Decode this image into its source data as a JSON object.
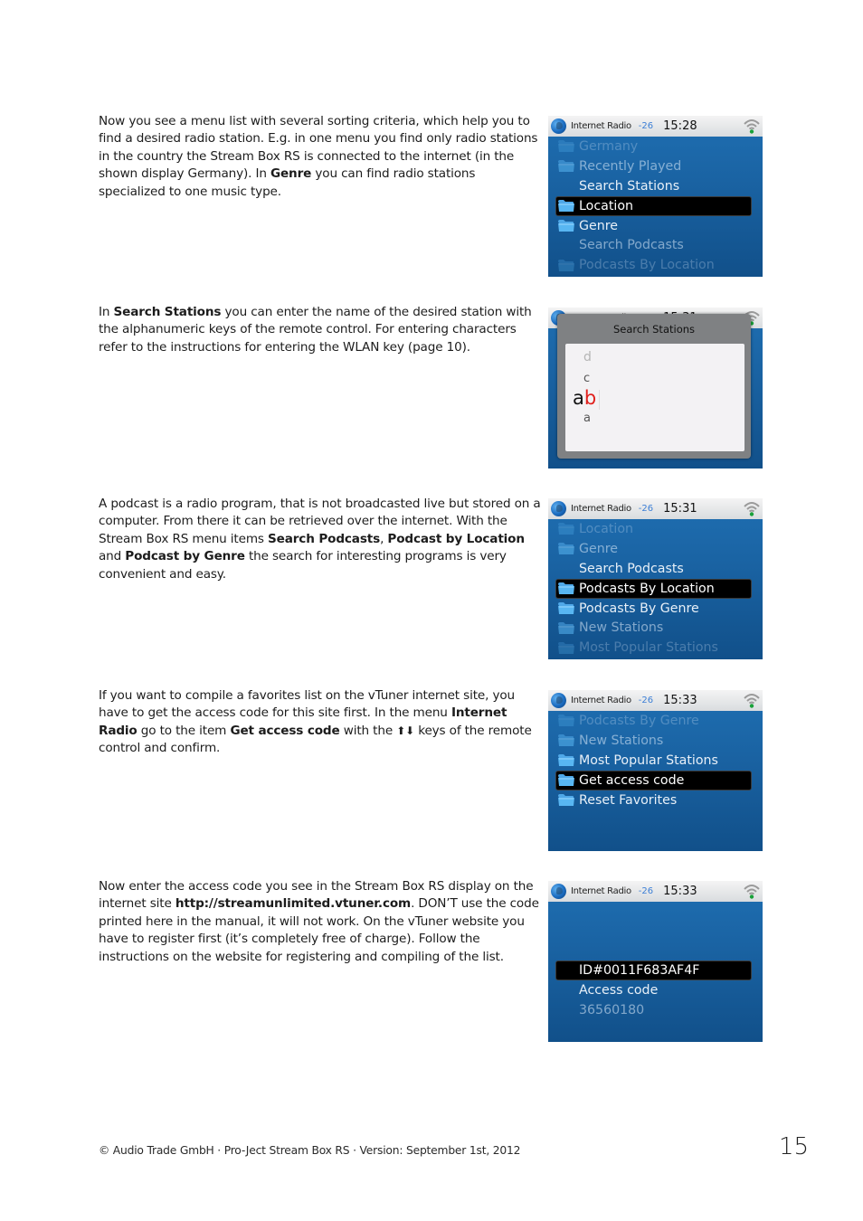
{
  "paragraphs": [
    {
      "parts": [
        {
          "t": "Now you see a menu list with several sorting criteria, which help you to find a desired radio station. E.g. in one menu you find only radio stations in the country the Stream Box RS is connected to the internet (in the shown display Germany). In "
        },
        {
          "b": "Genre"
        },
        {
          "t": " you can find radio stations specialized to one music type."
        }
      ]
    },
    {
      "parts": [
        {
          "t": "In  "
        },
        {
          "b": "Search Stations"
        },
        {
          "t": " you can enter the name of the desired station with the alphanumeric keys of the remote control. For entering characters refer to the instructions for entering the WLAN key (page 10)."
        }
      ]
    },
    {
      "parts": [
        {
          "t": "A podcast is a radio program, that is not broadcasted live but stored on a computer. From there it can be retrieved over the internet. With the Stream Box RS menu items "
        },
        {
          "b": "Search Podcasts"
        },
        {
          "t": ", "
        },
        {
          "b": "Podcast by Location"
        },
        {
          "t": " and "
        },
        {
          "b": "Podcast by Genre"
        },
        {
          "t": " the search for interesting programs is very convenient and easy."
        }
      ]
    },
    {
      "parts": [
        {
          "t": "If you want to compile a favorites list on the vTuner internet site, you have to get the access code for this site first. In the menu "
        },
        {
          "b": "Internet Radio"
        },
        {
          "t": " go to the item "
        },
        {
          "b": "Get access code"
        },
        {
          "t": " with the "
        },
        {
          "icon": "up-down-arrows",
          "glyph": "⬆⬇"
        },
        {
          "t": " keys of the remote control and confirm."
        }
      ]
    },
    {
      "parts": [
        {
          "t": "Now enter the access code you see in the Stream Box RS display on the internet site "
        },
        {
          "b": "http://streamunlimited.vtuner.com"
        },
        {
          "t": ". DON’T use the code printed here in the manual, it will not work. On the vTuner website you have to register first (it’s completely free of charge). Follow the instructions on the website for registering and compiling of the list."
        }
      ]
    }
  ],
  "screens": [
    {
      "status": {
        "title": "Internet Radio",
        "signal": "-26",
        "time": "15:28"
      },
      "items": [
        {
          "label": "Germany",
          "folder": true,
          "fade": 2
        },
        {
          "label": "Recently Played",
          "folder": true,
          "fade": 1
        },
        {
          "label": "Search Stations",
          "folder": false,
          "fade": 0
        },
        {
          "label": "Location",
          "folder": true,
          "fade": 0,
          "selected": true
        },
        {
          "label": "Genre",
          "folder": true,
          "fade": 0
        },
        {
          "label": "Search Podcasts",
          "folder": false,
          "fade": 1
        },
        {
          "label": "Podcasts By Location",
          "folder": true,
          "fade": 2
        }
      ]
    },
    {
      "status": {
        "title": "Internet Radio",
        "signal": "-26",
        "time": "15:31"
      },
      "popup": {
        "title": "Search Stations",
        "chars_above": [
          "d",
          "c"
        ],
        "input_committed": "a",
        "input_active": "b",
        "chars_below": [
          "a"
        ]
      }
    },
    {
      "status": {
        "title": "Internet Radio",
        "signal": "-26",
        "time": "15:31"
      },
      "items": [
        {
          "label": "Location",
          "folder": true,
          "fade": 2
        },
        {
          "label": "Genre",
          "folder": true,
          "fade": 1
        },
        {
          "label": "Search Podcasts",
          "folder": false,
          "fade": 0
        },
        {
          "label": "Podcasts By Location",
          "folder": true,
          "fade": 0,
          "selected": true
        },
        {
          "label": "Podcasts By Genre",
          "folder": true,
          "fade": 0
        },
        {
          "label": "New Stations",
          "folder": true,
          "fade": 1
        },
        {
          "label": "Most Popular Stations",
          "folder": true,
          "fade": 2
        }
      ]
    },
    {
      "status": {
        "title": "Internet Radio",
        "signal": "-26",
        "time": "15:33"
      },
      "items": [
        {
          "label": "Podcasts By Genre",
          "folder": true,
          "fade": 2
        },
        {
          "label": "New Stations",
          "folder": true,
          "fade": 1
        },
        {
          "label": "Most Popular Stations",
          "folder": true,
          "fade": 0
        },
        {
          "label": "Get access code",
          "folder": true,
          "fade": 0,
          "selected": true
        },
        {
          "label": "Reset Favorites",
          "folder": true,
          "fade": 0
        }
      ]
    },
    {
      "status": {
        "title": "Internet Radio",
        "signal": "-26",
        "time": "15:33"
      },
      "access": [
        {
          "label": "ID#0011F683AF4F",
          "fade": 0,
          "selected": true
        },
        {
          "label": "Access code",
          "fade": 0
        },
        {
          "label": "36560180",
          "fade": 1
        }
      ]
    }
  ],
  "footer": {
    "text": "© Audio Trade GmbH · Pro-Ject Stream Box RS · Version: September 1st, 2012",
    "page_number": "15"
  }
}
